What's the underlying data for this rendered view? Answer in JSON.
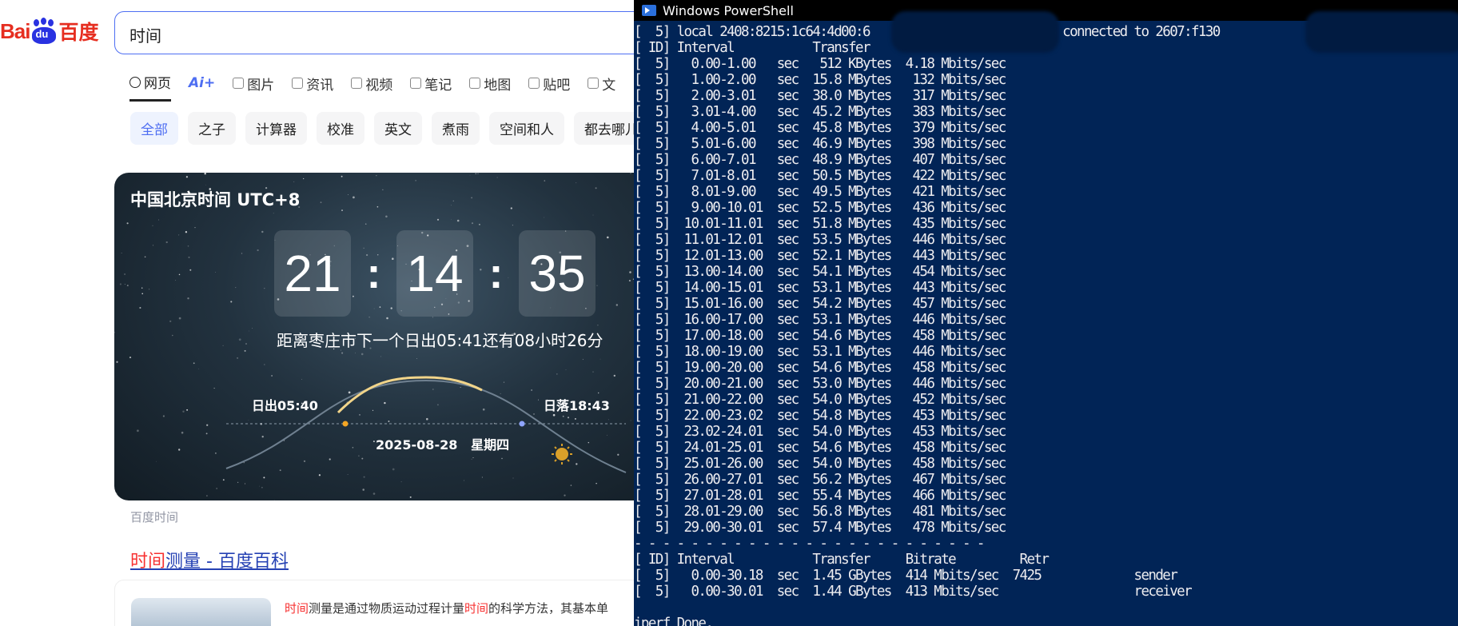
{
  "baidu": {
    "logo": {
      "latin": "Bai",
      "paw_text": "du",
      "chinese": "百度"
    },
    "search": {
      "value": "时间"
    },
    "tabs": [
      {
        "label": "网页",
        "icon": "search-icon",
        "active": true
      },
      {
        "label": "Ai+",
        "icon": "ai-icon"
      },
      {
        "label": "图片",
        "icon": "image-icon"
      },
      {
        "label": "资讯",
        "icon": "news-icon"
      },
      {
        "label": "视频",
        "icon": "video-icon"
      },
      {
        "label": "笔记",
        "icon": "note-icon"
      },
      {
        "label": "地图",
        "icon": "map-icon"
      },
      {
        "label": "贴吧",
        "icon": "tieba-icon"
      },
      {
        "label": "文",
        "icon": "doc-icon"
      }
    ],
    "chips": [
      "全部",
      "之子",
      "计算器",
      "校准",
      "英文",
      "煮雨",
      "空间和人",
      "都去哪儿"
    ],
    "time_card": {
      "title": "中国北京时间 UTC+8",
      "hours": "21",
      "minutes": "14",
      "seconds": "35",
      "sunrise_text": "距离枣庄市下一个日出05:41还有08小时26分",
      "sunrise_label": "日出05:40",
      "sunset_label": "日落18:43",
      "date": "2025-08-28",
      "weekday": "星期四"
    },
    "card_source": "百度时间",
    "result": {
      "title_hl": "时间",
      "title_rest": "测量 - 百度百科",
      "snippet": [
        {
          "text": "时间",
          "hl": true
        },
        {
          "text": "测量是通过物质运动过程计量",
          "hl": false
        },
        {
          "text": "时间",
          "hl": true
        },
        {
          "text": "的科学方法，其基本单",
          "hl": false
        }
      ]
    }
  },
  "powershell": {
    "title": "Windows PowerShell",
    "header_line": "[  5] local 2408:8215:1c64:4d00:6                 port 4063 connected to 2607:f130",
    "columns_line": "[ ID] Interval           Transfer",
    "rows": [
      {
        "id": "5",
        "interval": "0.00-1.00",
        "unit": "sec",
        "transfer": "512 KBytes",
        "bitrate": "4.18 Mbits/sec"
      },
      {
        "id": "5",
        "interval": "1.00-2.00",
        "unit": "sec",
        "transfer": "15.8 MBytes",
        "bitrate": "132 Mbits/sec"
      },
      {
        "id": "5",
        "interval": "2.00-3.01",
        "unit": "sec",
        "transfer": "38.0 MBytes",
        "bitrate": "317 Mbits/sec"
      },
      {
        "id": "5",
        "interval": "3.01-4.00",
        "unit": "sec",
        "transfer": "45.2 MBytes",
        "bitrate": "383 Mbits/sec"
      },
      {
        "id": "5",
        "interval": "4.00-5.01",
        "unit": "sec",
        "transfer": "45.8 MBytes",
        "bitrate": "379 Mbits/sec"
      },
      {
        "id": "5",
        "interval": "5.01-6.00",
        "unit": "sec",
        "transfer": "46.9 MBytes",
        "bitrate": "398 Mbits/sec"
      },
      {
        "id": "5",
        "interval": "6.00-7.01",
        "unit": "sec",
        "transfer": "48.9 MBytes",
        "bitrate": "407 Mbits/sec"
      },
      {
        "id": "5",
        "interval": "7.01-8.01",
        "unit": "sec",
        "transfer": "50.5 MBytes",
        "bitrate": "422 Mbits/sec"
      },
      {
        "id": "5",
        "interval": "8.01-9.00",
        "unit": "sec",
        "transfer": "49.5 MBytes",
        "bitrate": "421 Mbits/sec"
      },
      {
        "id": "5",
        "interval": "9.00-10.01",
        "unit": "sec",
        "transfer": "52.5 MBytes",
        "bitrate": "436 Mbits/sec"
      },
      {
        "id": "5",
        "interval": "10.01-11.01",
        "unit": "sec",
        "transfer": "51.8 MBytes",
        "bitrate": "435 Mbits/sec"
      },
      {
        "id": "5",
        "interval": "11.01-12.01",
        "unit": "sec",
        "transfer": "53.5 MBytes",
        "bitrate": "446 Mbits/sec"
      },
      {
        "id": "5",
        "interval": "12.01-13.00",
        "unit": "sec",
        "transfer": "52.1 MBytes",
        "bitrate": "443 Mbits/sec"
      },
      {
        "id": "5",
        "interval": "13.00-14.00",
        "unit": "sec",
        "transfer": "54.1 MBytes",
        "bitrate": "454 Mbits/sec"
      },
      {
        "id": "5",
        "interval": "14.00-15.01",
        "unit": "sec",
        "transfer": "53.1 MBytes",
        "bitrate": "443 Mbits/sec"
      },
      {
        "id": "5",
        "interval": "15.01-16.00",
        "unit": "sec",
        "transfer": "54.2 MBytes",
        "bitrate": "457 Mbits/sec"
      },
      {
        "id": "5",
        "interval": "16.00-17.00",
        "unit": "sec",
        "transfer": "53.1 MBytes",
        "bitrate": "446 Mbits/sec"
      },
      {
        "id": "5",
        "interval": "17.00-18.00",
        "unit": "sec",
        "transfer": "54.6 MBytes",
        "bitrate": "458 Mbits/sec"
      },
      {
        "id": "5",
        "interval": "18.00-19.00",
        "unit": "sec",
        "transfer": "53.1 MBytes",
        "bitrate": "446 Mbits/sec"
      },
      {
        "id": "5",
        "interval": "19.00-20.00",
        "unit": "sec",
        "transfer": "54.6 MBytes",
        "bitrate": "458 Mbits/sec"
      },
      {
        "id": "5",
        "interval": "20.00-21.00",
        "unit": "sec",
        "transfer": "53.0 MBytes",
        "bitrate": "446 Mbits/sec"
      },
      {
        "id": "5",
        "interval": "21.00-22.00",
        "unit": "sec",
        "transfer": "54.0 MBytes",
        "bitrate": "452 Mbits/sec"
      },
      {
        "id": "5",
        "interval": "22.00-23.02",
        "unit": "sec",
        "transfer": "54.8 MBytes",
        "bitrate": "453 Mbits/sec"
      },
      {
        "id": "5",
        "interval": "23.02-24.01",
        "unit": "sec",
        "transfer": "54.0 MBytes",
        "bitrate": "453 Mbits/sec"
      },
      {
        "id": "5",
        "interval": "24.01-25.01",
        "unit": "sec",
        "transfer": "54.6 MBytes",
        "bitrate": "458 Mbits/sec"
      },
      {
        "id": "5",
        "interval": "25.01-26.00",
        "unit": "sec",
        "transfer": "54.0 MBytes",
        "bitrate": "458 Mbits/sec"
      },
      {
        "id": "5",
        "interval": "26.00-27.01",
        "unit": "sec",
        "transfer": "56.2 MBytes",
        "bitrate": "467 Mbits/sec"
      },
      {
        "id": "5",
        "interval": "27.01-28.01",
        "unit": "sec",
        "transfer": "55.4 MBytes",
        "bitrate": "466 Mbits/sec"
      },
      {
        "id": "5",
        "interval": "28.01-29.00",
        "unit": "sec",
        "transfer": "56.8 MBytes",
        "bitrate": "481 Mbits/sec"
      },
      {
        "id": "5",
        "interval": "29.00-30.01",
        "unit": "sec",
        "transfer": "57.4 MBytes",
        "bitrate": "478 Mbits/sec"
      }
    ],
    "separator": "- - - - - - - - - - - - - - - - - - - - - - - - -",
    "summary_header": "[ ID] Interval           Transfer     Bitrate         Retr",
    "summary": [
      {
        "id": "5",
        "interval": "0.00-30.18",
        "unit": "sec",
        "transfer": "1.45 GBytes",
        "bitrate": "414 Mbits/sec",
        "retr": "7425",
        "role": "sender"
      },
      {
        "id": "5",
        "interval": "0.00-30.01",
        "unit": "sec",
        "transfer": "1.44 GBytes",
        "bitrate": "413 Mbits/sec",
        "retr": "",
        "role": "receiver"
      }
    ],
    "footer": "iperf Done."
  }
}
